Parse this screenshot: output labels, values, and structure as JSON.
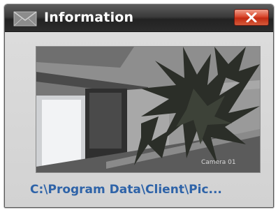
{
  "window": {
    "title": "Information",
    "icon": "envelope-icon",
    "close_icon": "close-x-icon"
  },
  "snapshot": {
    "camera_label": "Camera 01",
    "file_path": "C:\\Program Data\\Client\\Pic..."
  },
  "colors": {
    "titlebar": "#2c2c2c",
    "close_button": "#d9472c",
    "path_link": "#2e63a8"
  }
}
